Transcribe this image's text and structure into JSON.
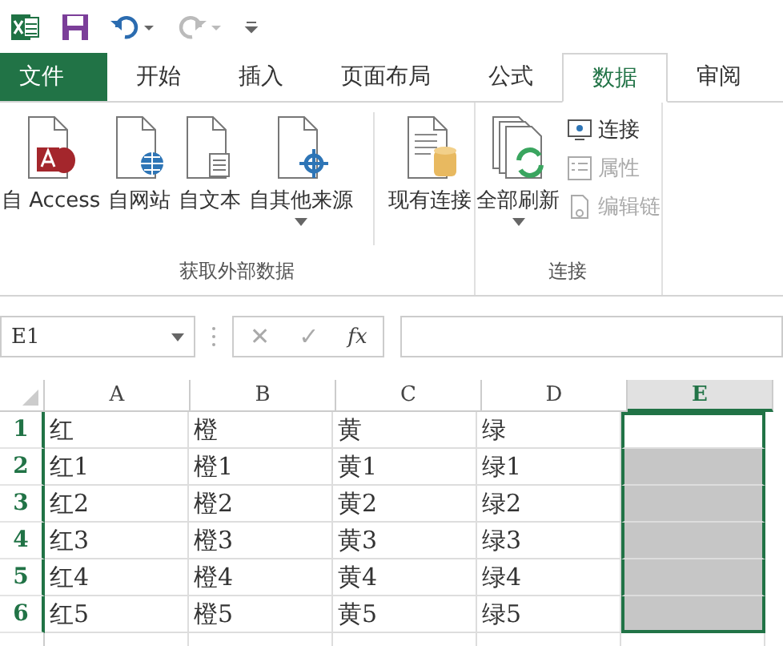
{
  "quick_access": [
    {
      "kind": "excel"
    },
    {
      "kind": "save"
    },
    {
      "kind": "undo"
    },
    {
      "kind": "redo"
    },
    {
      "kind": "customize"
    }
  ],
  "tabs": [
    {
      "label": "文件",
      "kind": "file",
      "selected": false
    },
    {
      "label": "开始",
      "kind": "tab",
      "selected": false
    },
    {
      "label": "插入",
      "kind": "tab",
      "selected": false
    },
    {
      "label": "页面布局",
      "kind": "tab",
      "selected": false
    },
    {
      "label": "公式",
      "kind": "tab",
      "selected": false
    },
    {
      "label": "数据",
      "kind": "tab",
      "selected": true
    },
    {
      "label": "审阅",
      "kind": "tab",
      "selected": false
    }
  ],
  "ribbon_groups": [
    {
      "label": "获取外部数据",
      "buttons": [
        {
          "label": "自 Access",
          "kind": "access",
          "dropdown": false
        },
        {
          "label": "自网站",
          "kind": "web",
          "dropdown": false
        },
        {
          "label": "自文本",
          "kind": "text",
          "dropdown": false
        },
        {
          "label": "自其他来源",
          "kind": "other",
          "dropdown": true
        },
        {
          "label": "现有连接",
          "kind": "existing",
          "dropdown": false,
          "separated": true
        }
      ]
    },
    {
      "label": "连接",
      "buttons": [
        {
          "label": "全部刷新",
          "kind": "refresh",
          "dropdown": true
        }
      ],
      "small_buttons": [
        {
          "label": "连接",
          "kind": "connect",
          "disabled": false
        },
        {
          "label": "属性",
          "kind": "props",
          "disabled": true
        },
        {
          "label": "编辑链",
          "kind": "link",
          "disabled": true
        }
      ]
    }
  ],
  "name_box": {
    "value": "E1"
  },
  "formula_bar": {
    "cancel": "✕",
    "enter": "✓",
    "fx": "fx"
  },
  "grid": {
    "columns": [
      {
        "label": "A",
        "selected": false
      },
      {
        "label": "B",
        "selected": false
      },
      {
        "label": "C",
        "selected": false
      },
      {
        "label": "D",
        "selected": false
      },
      {
        "label": "E",
        "selected": true
      }
    ],
    "rows": [
      {
        "number": "1",
        "cells": [
          "红",
          "橙",
          "黄",
          "绿"
        ],
        "selected": true,
        "active": true
      },
      {
        "number": "2",
        "cells": [
          "红1",
          "橙1",
          "黄1",
          "绿1"
        ],
        "selected": true,
        "active": false
      },
      {
        "number": "3",
        "cells": [
          "红2",
          "橙2",
          "黄2",
          "绿2"
        ],
        "selected": true,
        "active": false
      },
      {
        "number": "4",
        "cells": [
          "红3",
          "橙3",
          "黄3",
          "绿3"
        ],
        "selected": true,
        "active": false
      },
      {
        "number": "5",
        "cells": [
          "红4",
          "橙4",
          "黄4",
          "绿4"
        ],
        "selected": true,
        "active": false
      },
      {
        "number": "6",
        "cells": [
          "红5",
          "橙5",
          "黄5",
          "绿5"
        ],
        "selected": true,
        "active": false
      }
    ]
  }
}
